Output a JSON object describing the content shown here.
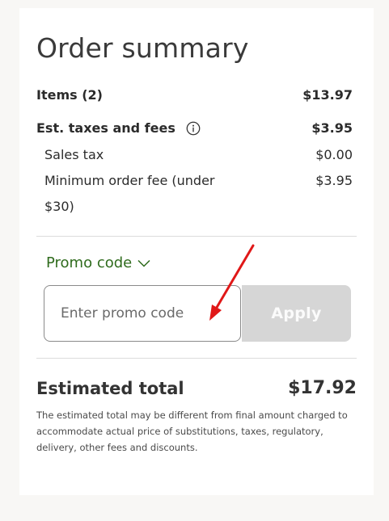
{
  "summary": {
    "title": "Order summary",
    "items_label": "Items (2)",
    "items_value": "$13.97",
    "taxes_label": "Est. taxes and fees",
    "taxes_value": "$3.95",
    "sales_tax_label": "Sales tax",
    "sales_tax_value": "$0.00",
    "min_fee_label": "Minimum order fee (under $30)",
    "min_fee_value": "$3.95"
  },
  "promo": {
    "toggle_label": "Promo code",
    "input_placeholder": "Enter promo code",
    "input_value": "",
    "apply_label": "Apply"
  },
  "total": {
    "label": "Estimated total",
    "value": "$17.92",
    "disclaimer": "The estimated total may be different from final amount charged to accommodate actual price of substitutions, taxes, regulatory, delivery, other fees and discounts."
  },
  "icons": {
    "info": "info-circle-icon",
    "chevron": "chevron-down-icon",
    "arrow": "red-annotation-arrow"
  },
  "colors": {
    "promo_green": "#2f6b1d",
    "apply_disabled": "#d6d6d6",
    "annotation_red": "#e01818"
  }
}
